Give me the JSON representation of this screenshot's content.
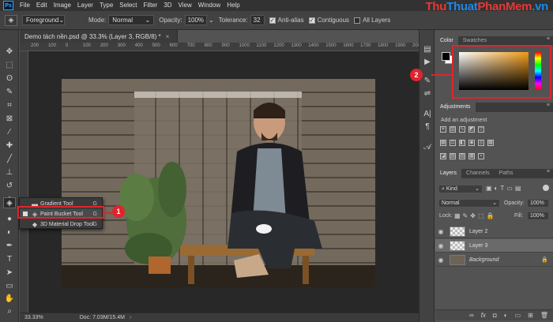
{
  "app": {
    "logo": "Ps",
    "brand": {
      "part1": "Thu",
      "part2": "Thuat",
      "part3": "PhanMem",
      "part4": ".vn"
    }
  },
  "menu": [
    "File",
    "Edit",
    "Image",
    "Layer",
    "Type",
    "Select",
    "Filter",
    "3D",
    "View",
    "Window",
    "Help"
  ],
  "options": {
    "fill_source": "Foreground",
    "mode_label": "Mode:",
    "mode_value": "Normal",
    "opacity_label": "Opacity:",
    "opacity_value": "100%",
    "tolerance_label": "Tolerance:",
    "tolerance_value": "32",
    "antialias": "Anti-alias",
    "contiguous": "Contiguous",
    "all_layers": "All Layers"
  },
  "document": {
    "tab_title": "Demo tách nền.psd @ 33.3% (Layer 3, RGB/8) *",
    "ruler_marks": [
      "200",
      "100",
      "0",
      "100",
      "200",
      "300",
      "400",
      "500",
      "600",
      "700",
      "800",
      "900",
      "1000",
      "1100",
      "1200",
      "1300",
      "1400",
      "1500",
      "1600",
      "1700",
      "1800",
      "1900",
      "2000"
    ],
    "zoom": "33.33%",
    "doc_size": "Doc: 7.03M/15.4M"
  },
  "flyout": [
    {
      "label": "Gradient Tool",
      "key": "G",
      "icon": "gradient-icon"
    },
    {
      "label": "Paint Bucket Tool",
      "key": "G",
      "icon": "paint-bucket-icon"
    },
    {
      "label": "3D Material Drop Tool",
      "key": "G",
      "icon": "3d-material-drop-icon"
    }
  ],
  "callouts": {
    "one": "1",
    "two": "2"
  },
  "panels": {
    "color_tabs": [
      "Color",
      "Swatches"
    ],
    "adjustments_title": "Adjustments",
    "adjustments_hint": "Add an adjustment",
    "layers_tabs": [
      "Layers",
      "Channels",
      "Paths"
    ],
    "kind_filter": "Kind",
    "blend_mode": "Normal",
    "opacity_label": "Opacity:",
    "opacity_value": "100%",
    "lock_label": "Lock:",
    "fill_label": "Fill:",
    "fill_value": "100%",
    "layers": [
      {
        "name": "Layer 2"
      },
      {
        "name": "Layer 3"
      },
      {
        "name": "Background"
      }
    ]
  },
  "colors": {
    "accent_red": "#e0242d",
    "brand_blue": "#1e88e5",
    "brand_red": "#e53935"
  }
}
